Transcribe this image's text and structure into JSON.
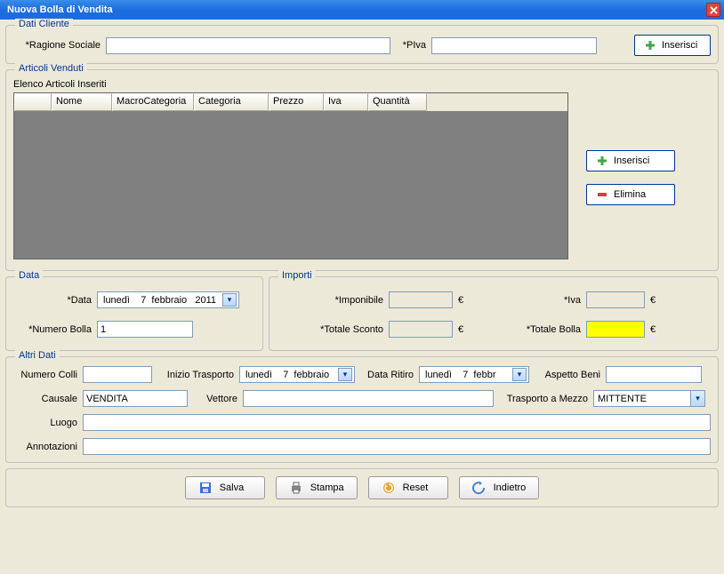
{
  "window": {
    "title": "Nuova Bolla di Vendita"
  },
  "dati_cliente": {
    "legend": "Dati Cliente",
    "ragione_sociale_label": "*Ragione Sociale",
    "ragione_sociale_value": "",
    "piva_label": "*PIva",
    "piva_value": "",
    "inserisci_label": "Inserisci"
  },
  "articoli": {
    "legend": "Articoli Venduti",
    "elenco_label": "Elenco Articoli Inseriti",
    "columns": [
      "",
      "Nome",
      "MacroCategoria",
      "Categoria",
      "Prezzo",
      "Iva",
      "Quantità"
    ],
    "inserisci_label": "Inserisci",
    "elimina_label": "Elimina"
  },
  "data": {
    "legend": "Data",
    "data_label": "*Data",
    "data_value": "lunedì    7  febbraio   2011",
    "numero_bolla_label": "*Numero Bolla",
    "numero_bolla_value": "1"
  },
  "importi": {
    "legend": "Importi",
    "imponibile_label": "*Imponibile",
    "imponibile_value": "",
    "iva_label": "*Iva",
    "iva_value": "",
    "totale_sconto_label": "*Totale Sconto",
    "totale_sconto_value": "",
    "totale_bolla_label": "*Totale Bolla",
    "totale_bolla_value": "",
    "currency": "€"
  },
  "altri": {
    "legend": "Altri Dati",
    "numero_colli_label": "Numero Colli",
    "numero_colli_value": "",
    "inizio_trasporto_label": "Inizio Trasporto",
    "inizio_trasporto_value": "lunedì    7  febbraio",
    "data_ritiro_label": "Data Ritiro",
    "data_ritiro_value": "lunedì    7  febbr",
    "aspetto_beni_label": "Aspetto Beni",
    "aspetto_beni_value": "",
    "causale_label": "Causale",
    "causale_value": "VENDITA",
    "vettore_label": "Vettore",
    "vettore_value": "",
    "trasporto_mezzo_label": "Trasporto a Mezzo",
    "trasporto_mezzo_value": "MITTENTE",
    "luogo_label": "Luogo",
    "luogo_value": "",
    "annotazioni_label": "Annotazioni",
    "annotazioni_value": ""
  },
  "actions": {
    "salva": "Salva",
    "stampa": "Stampa",
    "reset": "Reset",
    "indietro": "Indietro"
  }
}
